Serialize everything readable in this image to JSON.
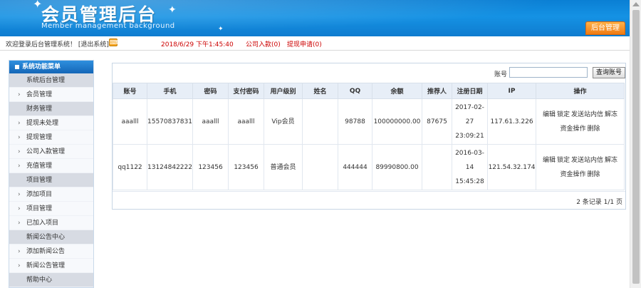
{
  "header": {
    "title": "会员管理后台",
    "subtitle": "Member management background",
    "admin_button": "后台管理"
  },
  "topbar": {
    "welcome": "欢迎登录后台管理系统！ [退出系统]",
    "datetime": "2018/6/29 下午1:45:40",
    "inquiry": "公司入款(0)",
    "withdraw": "提现申请(0)"
  },
  "sidebar": {
    "title": "系统功能菜单",
    "entries": [
      {
        "type": "section",
        "label": "系统后台管理"
      },
      {
        "type": "item",
        "label": "会员管理"
      },
      {
        "type": "section",
        "label": "财务管理"
      },
      {
        "type": "item",
        "label": "提现未处理"
      },
      {
        "type": "item",
        "label": "提现管理"
      },
      {
        "type": "item",
        "label": "公司入款管理"
      },
      {
        "type": "item",
        "label": "充值管理"
      },
      {
        "type": "section",
        "label": "项目管理"
      },
      {
        "type": "item",
        "label": "添加项目"
      },
      {
        "type": "item",
        "label": "项目管理"
      },
      {
        "type": "item",
        "label": "已加入项目"
      },
      {
        "type": "section",
        "label": "新闻公告中心"
      },
      {
        "type": "item",
        "label": "添加新闻公告"
      },
      {
        "type": "item",
        "label": "新闻公告管理"
      },
      {
        "type": "section",
        "label": "帮助中心"
      }
    ]
  },
  "search": {
    "label": "账号",
    "value": "",
    "button": "查询账号"
  },
  "table": {
    "columns": [
      "账号",
      "手机",
      "密码",
      "支付密码",
      "用户级别",
      "姓名",
      "QQ",
      "余额",
      "推荐人",
      "注册日期",
      "IP",
      "操作"
    ],
    "rows": [
      {
        "account": "aaalll",
        "phone": "15570837831",
        "password": "aaalll",
        "pay_password": "aaalll",
        "level": "Vip会员",
        "name": "",
        "qq": "98788",
        "balance": "100000000.00",
        "referrer": "87675",
        "reg_date_1": "2017-02-",
        "reg_date_2": "27",
        "reg_date_3": "23:09:21",
        "ip": "117.61.3.226",
        "ops": [
          "编辑",
          "锁定",
          "发送站内信",
          "解冻",
          "资金操作",
          "删除"
        ]
      },
      {
        "account": "qq1122",
        "phone": "13124842222",
        "password": "123456",
        "pay_password": "123456",
        "level": "普通会员",
        "name": "",
        "qq": "444444",
        "balance": "89990800.00",
        "referrer": "",
        "reg_date_1": "2016-03-",
        "reg_date_2": "14",
        "reg_date_3": "15:45:28",
        "ip": "121.54.32.174",
        "ops": [
          "编辑",
          "锁定",
          "发送站内信",
          "解冻",
          "资金操作",
          "删除"
        ]
      }
    ]
  },
  "pagination": {
    "summary": "2 条记录 1/1 页"
  },
  "colors": {
    "header_blue": "#0f7ccf",
    "accent_orange": "#f07a12",
    "alert_red": "#cc0000"
  },
  "icons": [
    "keyboard-icon",
    "chevron-right-icon",
    "star-icon",
    "scroll-up-arrow-icon"
  ]
}
